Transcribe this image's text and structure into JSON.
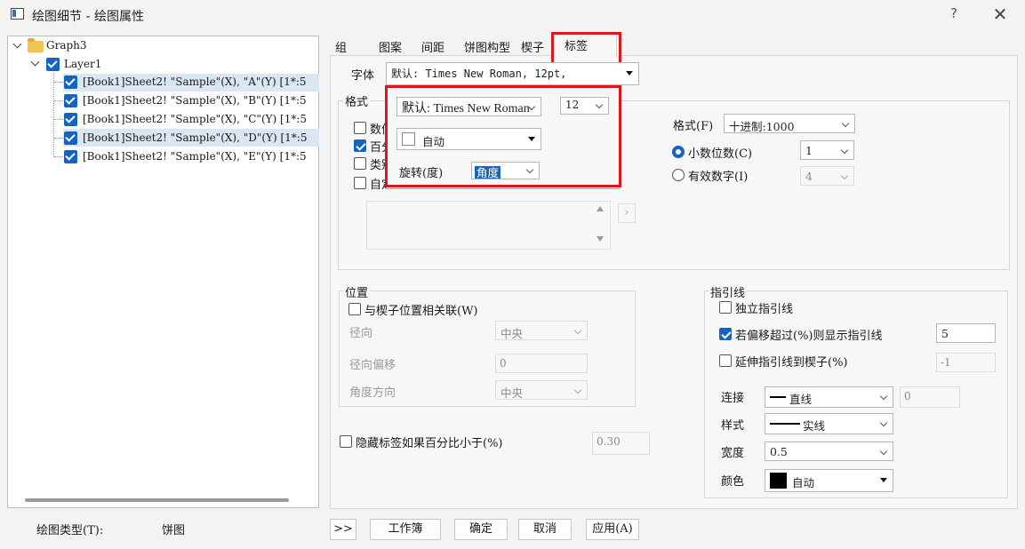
{
  "window": {
    "title": "绘图细节 - 绘图属性",
    "help": "?",
    "close": "✕"
  },
  "tree": {
    "root": "Graph3",
    "layer": "Layer1",
    "items": [
      "[Book1]Sheet2! \"Sample\"(X), \"A\"(Y) [1*:5",
      "[Book1]Sheet2! \"Sample\"(X), \"B\"(Y) [1*:5",
      "[Book1]Sheet2! \"Sample\"(X), \"C\"(Y) [1*:5",
      "[Book1]Sheet2! \"Sample\"(X), \"D\"(Y) [1*:5",
      "[Book1]Sheet2! \"Sample\"(X), \"E\"(Y) [1*:5"
    ]
  },
  "plot_type": {
    "label": "绘图类型(T):",
    "value": "饼图"
  },
  "tabs": [
    "组",
    "图案",
    "间距",
    "饼图构型",
    "楔子",
    "标签"
  ],
  "active_tab": "标签",
  "font_row": {
    "label": "字体",
    "value": "默认: Times New Roman, 12pt,"
  },
  "format_section": {
    "title": "格式",
    "checks": [
      "数值",
      "百分比",
      "类别",
      "自定义"
    ],
    "format_label": "格式(F)",
    "format_value": "十进制:1000",
    "decimal_label": "小数位数(C)",
    "decimal_value": "1",
    "sig_label": "有效数字(I)",
    "sig_value": "4"
  },
  "popup": {
    "font": "默认: Times New Roman",
    "size": "12",
    "color": "自动",
    "rotate_label": "旋转(度)",
    "rotate_value": "角度"
  },
  "position": {
    "title": "位置",
    "link_label": "与楔子位置相关联(W)",
    "radial_label": "径向",
    "radial_value": "中央",
    "radial_offset_label": "径向偏移",
    "radial_offset_value": "0",
    "angle_label": "角度方向",
    "angle_value": "中央"
  },
  "hide_label": {
    "text": "隐藏标签如果百分比小于(%)",
    "value": "0.30"
  },
  "leader": {
    "title": "指引线",
    "independent": "独立指引线",
    "show_if_offset": "若偏移超过(%)则显示指引线",
    "show_if_offset_value": "5",
    "extend": "延伸指引线到楔子(%)",
    "extend_value": "-1",
    "connect_label": "连接",
    "connect_value": "直线",
    "connect_num": "0",
    "style_label": "样式",
    "style_value": "实线",
    "width_label": "宽度",
    "width_value": "0.5",
    "color_label": "颜色",
    "color_value": "自动"
  },
  "buttons": {
    "expand": ">>",
    "workbook": "工作簿",
    "ok": "确定",
    "cancel": "取消",
    "apply": "应用(A)"
  },
  "colors": {
    "accent": "#1565c0",
    "highlight_box": "#d9191e"
  }
}
